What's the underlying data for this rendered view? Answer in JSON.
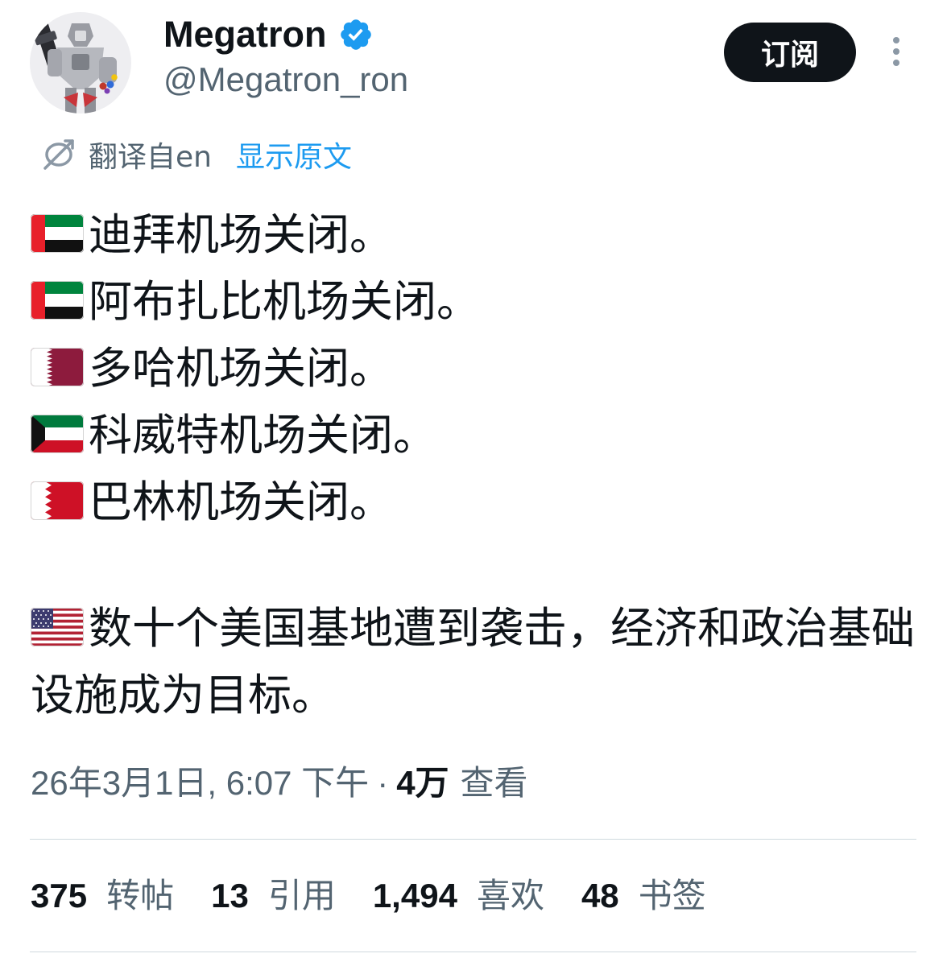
{
  "author": {
    "display_name": "Megatron",
    "handle": "@Megatron_ron",
    "verified": true,
    "badge_icon": "verified-badge-icon",
    "avatar_icon": "avatar-image"
  },
  "header": {
    "subscribe_label": "订阅",
    "more_icon": "more-vertical-icon"
  },
  "translation": {
    "icon": "translate-icon",
    "label": "翻译自en",
    "show_original": "显示原文"
  },
  "tweet": {
    "lines": [
      {
        "flag": "uae-flag-icon",
        "text": "迪拜机场关闭。"
      },
      {
        "flag": "uae-flag-icon",
        "text": "阿布扎比机场关闭。"
      },
      {
        "flag": "qatar-flag-icon",
        "text": "多哈机场关闭。"
      },
      {
        "flag": "kuwait-flag-icon",
        "text": "科威特机场关闭。"
      },
      {
        "flag": "bahrain-flag-icon",
        "text": "巴林机场关闭。"
      }
    ],
    "paragraph": {
      "flag": "usa-flag-icon",
      "text": "数十个美国基地遭到袭击，经济和政治基础设施成为目标。"
    }
  },
  "meta": {
    "timestamp": "26年3月1日, 6:07 下午",
    "separator": "·",
    "views_count": "4万",
    "views_label": "查看"
  },
  "stats": [
    {
      "count": "375",
      "label": "转帖"
    },
    {
      "count": "13",
      "label": "引用"
    },
    {
      "count": "1,494",
      "label": "喜欢"
    },
    {
      "count": "48",
      "label": "书签"
    }
  ],
  "colors": {
    "text_primary": "#0f1419",
    "text_secondary": "#536471",
    "accent": "#1d9bf0",
    "button_bg": "#0f1419",
    "divider": "#cfd9de"
  }
}
